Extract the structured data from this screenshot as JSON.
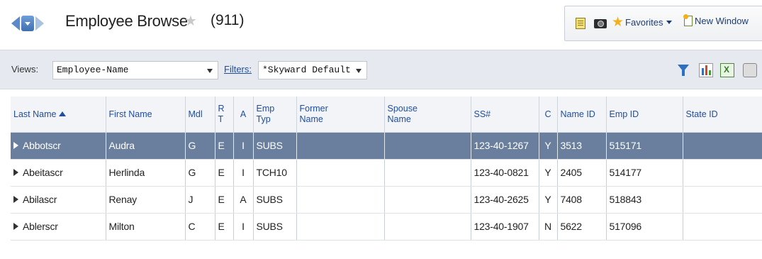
{
  "header": {
    "title": "Employee Browse",
    "count": "(911)",
    "toolbar": {
      "favorites_label": "Favorites",
      "new_window_label": "New Window"
    }
  },
  "views_bar": {
    "views_label": "Views:",
    "views_value": "Employee-Name",
    "filters_label": "Filters:",
    "filters_value": "*Skyward Default"
  },
  "grid": {
    "columns": [
      {
        "key": "last",
        "label": "Last Name",
        "sorted": "asc"
      },
      {
        "key": "first",
        "label": "First Name"
      },
      {
        "key": "mdl",
        "label": "Mdl"
      },
      {
        "key": "rt",
        "label": "R T"
      },
      {
        "key": "a",
        "label": "A"
      },
      {
        "key": "emptyp",
        "label": "Emp Typ"
      },
      {
        "key": "former",
        "label": "Former Name"
      },
      {
        "key": "spouse",
        "label": "Spouse Name"
      },
      {
        "key": "ss",
        "label": "SS#"
      },
      {
        "key": "c",
        "label": "C"
      },
      {
        "key": "nameid",
        "label": "Name ID"
      },
      {
        "key": "empid",
        "label": "Emp ID"
      },
      {
        "key": "stateid",
        "label": "State ID"
      }
    ],
    "rows": [
      {
        "last": "Abbotscr",
        "first": "Audra",
        "mdl": "G",
        "rt": "E",
        "a": "I",
        "emptyp": "SUBS",
        "former": "",
        "spouse": "",
        "ss": "123-40-1267",
        "c": "Y",
        "nameid": "3513",
        "empid": "515171",
        "stateid": "",
        "selected": true
      },
      {
        "last": "Abeitascr",
        "first": "Herlinda",
        "mdl": "G",
        "rt": "E",
        "a": "I",
        "emptyp": "TCH10",
        "former": "",
        "spouse": "",
        "ss": "123-40-0821",
        "c": "Y",
        "nameid": "2405",
        "empid": "514177",
        "stateid": ""
      },
      {
        "last": "Abilascr",
        "first": "Renay",
        "mdl": "J",
        "rt": "E",
        "a": "A",
        "emptyp": "SUBS",
        "former": "",
        "spouse": "",
        "ss": "123-40-2625",
        "c": "Y",
        "nameid": "7408",
        "empid": "518843",
        "stateid": ""
      },
      {
        "last": "Ablerscr",
        "first": "Milton",
        "mdl": "C",
        "rt": "E",
        "a": "I",
        "emptyp": "SUBS",
        "former": "",
        "spouse": "",
        "ss": "123-40-1907",
        "c": "N",
        "nameid": "5622",
        "empid": "517096",
        "stateid": ""
      }
    ]
  },
  "colors": {
    "selected_row": "#6a7f9d",
    "link": "#1f4ea0",
    "bar_bg": "#e6eaf0"
  },
  "icons": [
    "back-arrow-icon",
    "history-dropdown-icon",
    "forward-arrow-icon",
    "favorite-star-icon",
    "notes-icon",
    "camera-icon",
    "favorites-star-icon",
    "new-window-icon",
    "filter-funnel-icon",
    "chart-icon",
    "excel-export-icon",
    "print-icon",
    "row-expand-icon",
    "sort-asc-icon"
  ]
}
